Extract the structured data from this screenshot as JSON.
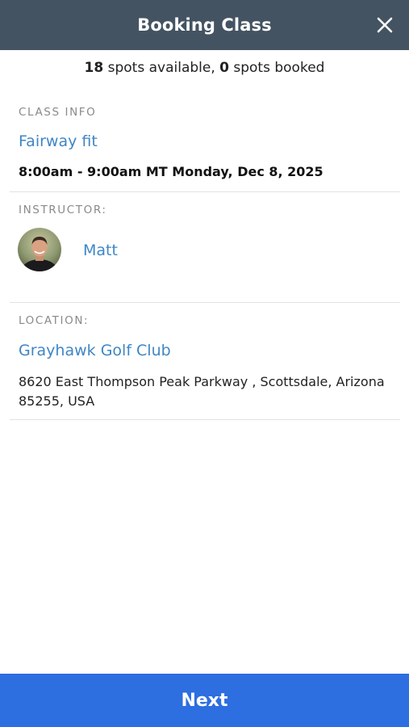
{
  "header": {
    "title": "Booking Class",
    "close_icon": "close-icon"
  },
  "availability": {
    "spots_available_count": "18",
    "spots_available_text": " spots available, ",
    "spots_booked_count": "0",
    "spots_booked_text": " spots booked"
  },
  "class_info": {
    "label": "CLASS INFO",
    "name": "Fairway fit",
    "time": "8:00am - 9:00am MT Monday, Dec 8, 2025"
  },
  "instructor": {
    "label": "INSTRUCTOR:",
    "name": "Matt",
    "avatar_icon": "avatar-photo"
  },
  "location": {
    "label": "LOCATION:",
    "name": "Grayhawk Golf Club",
    "address": "8620 East Thompson Peak Parkway , Scottsdale, Arizona 85255, USA"
  },
  "footer": {
    "next_label": "Next"
  },
  "colors": {
    "header_bg": "#435361",
    "link": "#3f86c6",
    "primary_button": "#2d6ee0"
  }
}
